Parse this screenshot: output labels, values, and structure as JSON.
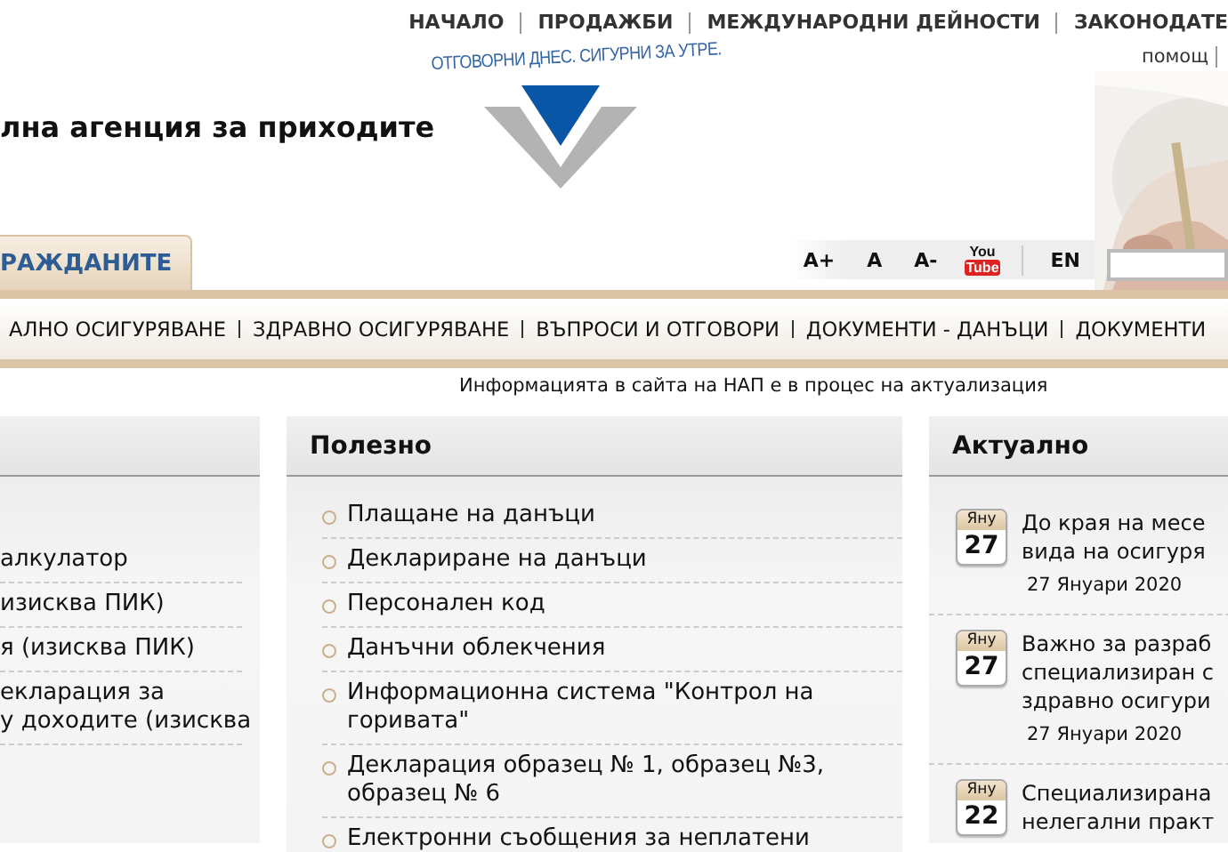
{
  "top_nav": [
    "НАЧАЛО",
    "ПРОДАЖБИ",
    "МЕЖДУНАРОДНИ ДЕЙНОСТИ",
    "ЗАКОНОДАТЕ"
  ],
  "help_link": "помощ",
  "slogan": "ОТГОВОРНИ ДНЕС. СИГУРНИ ЗА УТРЕ.",
  "site_title": "лна агенция за приходите",
  "tabs": [
    {
      "label": "РАЖДАНИТЕ",
      "selected": true
    }
  ],
  "toolbar": [
    {
      "kind": "text",
      "label": "A+"
    },
    {
      "kind": "text",
      "label": "A"
    },
    {
      "kind": "text",
      "label": "A-"
    },
    {
      "kind": "youtube",
      "top": "You",
      "bottom": "Tube"
    },
    {
      "kind": "text",
      "label": "EN"
    }
  ],
  "menu": [
    "АЛНО ОСИГУРЯВАНЕ",
    "ЗДРАВНО ОСИГУРЯВАНЕ",
    "ВЪПРОСИ И ОТГОВОРИ",
    "ДОКУМЕНТИ - ДАНЪЦИ",
    "ДОКУМЕНТИ"
  ],
  "notice": "Информацията в сайта на НАП е в процес на актуализация",
  "left_panel": {
    "items": [
      {
        "lines": [
          "алкулатор"
        ]
      },
      {
        "lines": [
          "изисква ПИК)"
        ]
      },
      {
        "lines": [
          "я (изисква ПИК)"
        ]
      },
      {
        "lines": [
          "екларация за",
          "у доходите (изисква"
        ]
      }
    ]
  },
  "useful_panel": {
    "title": "Полезно",
    "items": [
      {
        "lines": [
          "Плащане на данъци"
        ]
      },
      {
        "lines": [
          "Деклариране на данъци"
        ]
      },
      {
        "lines": [
          "Персонален код"
        ]
      },
      {
        "lines": [
          "Данъчни облекчения"
        ]
      },
      {
        "lines": [
          "Информационна система \"Контрол на",
          "горивата\""
        ]
      },
      {
        "lines": [
          "Декларация образец № 1, образец №3,",
          "образец № 6"
        ]
      },
      {
        "lines": [
          "Електронни съобщения за неплатени"
        ]
      }
    ]
  },
  "news_panel": {
    "title": "Актуално",
    "items": [
      {
        "month": "Яну",
        "day": "27",
        "lines": [
          "До края на месе",
          "вида на осигуря"
        ],
        "date": "27 Януари 2020"
      },
      {
        "month": "Яну",
        "day": "27",
        "lines": [
          "Важно за разраб",
          "специализиран с",
          "здравно осигури"
        ],
        "date": "27 Януари 2020"
      },
      {
        "month": "Яну",
        "day": "22",
        "lines": [
          "Специализирана",
          "нелегални практ"
        ]
      }
    ]
  }
}
